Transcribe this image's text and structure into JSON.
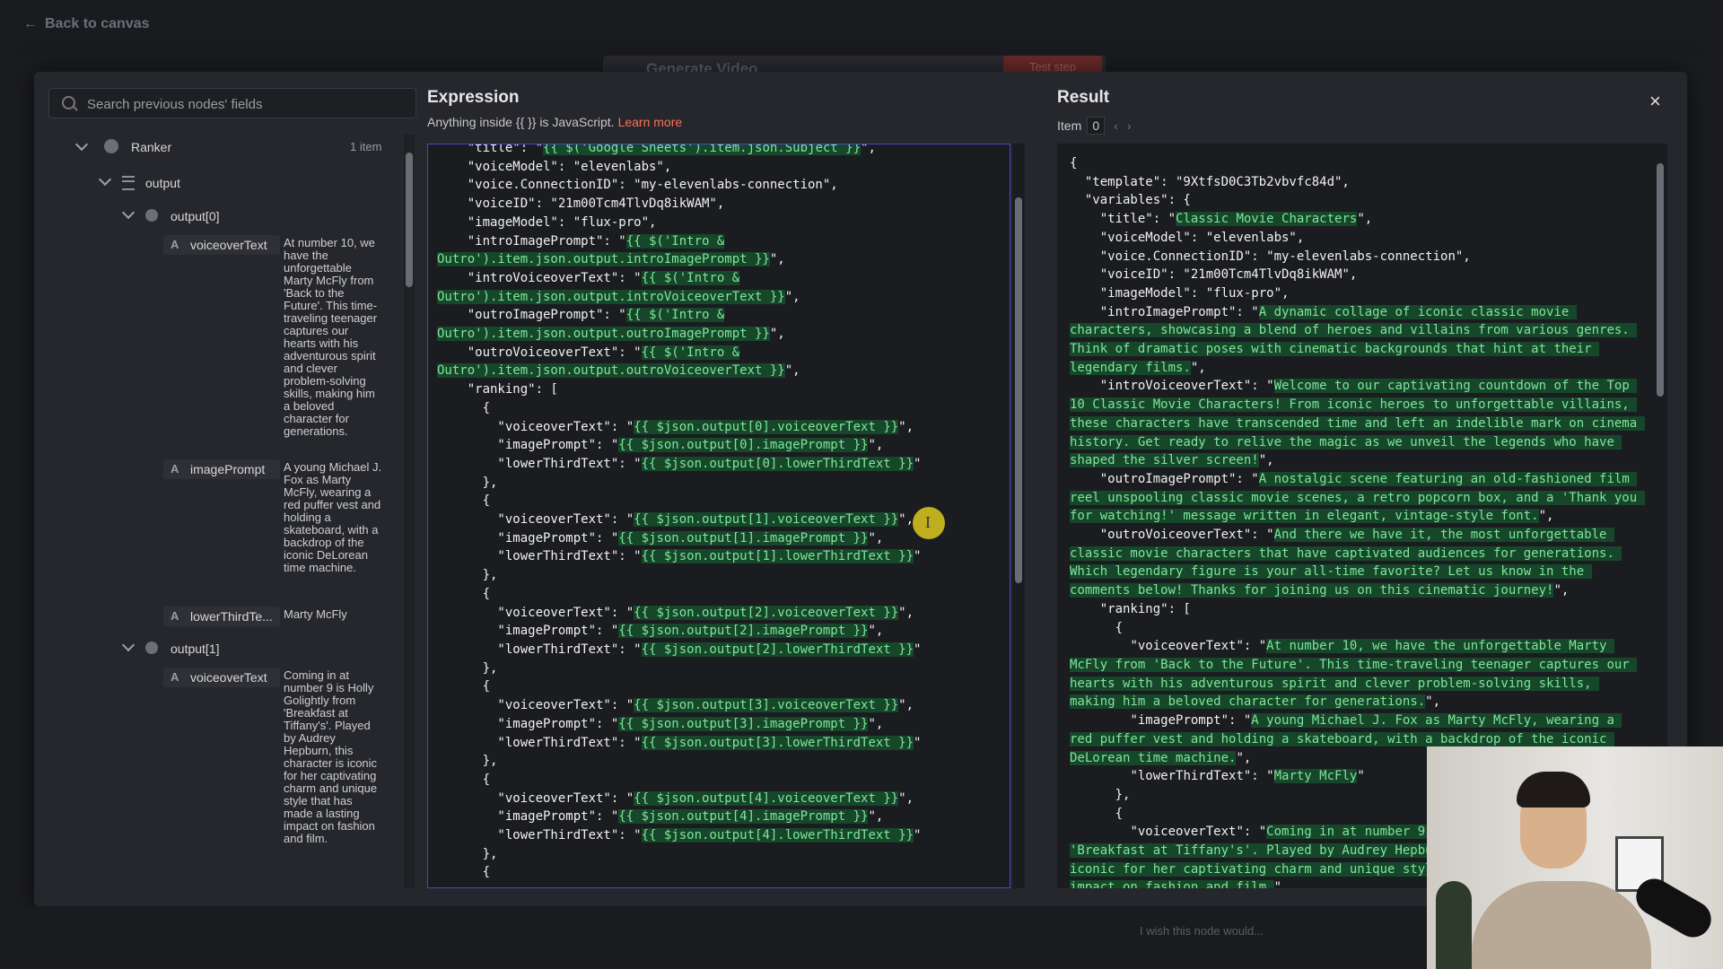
{
  "topbar": {
    "back_label": "Back to canvas",
    "node_title": "Generate Video",
    "test_step": "Test step"
  },
  "search": {
    "placeholder": "Search previous nodes' fields"
  },
  "tree": {
    "root_label": "Ranker",
    "root_count": "1 item",
    "output_label": "output",
    "items": [
      {
        "label": "output[0]",
        "fields": [
          {
            "type": "A",
            "name": "voiceoverText",
            "value": "At number 10, we have the unforgettable Marty McFly from 'Back to the Future'. This time-traveling teenager captures our hearts with his adventurous spirit and clever problem-solving skills, making him a beloved character for generations."
          },
          {
            "type": "A",
            "name": "imagePrompt",
            "value": "A young Michael J. Fox as Marty McFly, wearing a red puffer vest and holding a skateboard, with a backdrop of the iconic DeLorean time machine."
          },
          {
            "type": "A",
            "name": "lowerThirdTe...",
            "value": "Marty McFly"
          }
        ]
      },
      {
        "label": "output[1]",
        "fields": [
          {
            "type": "A",
            "name": "voiceoverText",
            "value": "Coming in at number 9 is Holly Golightly from 'Breakfast at Tiffany's'. Played by Audrey Hepburn, this character is iconic for her captivating charm and unique style that has made a lasting impact on fashion and film."
          }
        ]
      }
    ]
  },
  "expression": {
    "title": "Expression",
    "subtitle": "Anything inside {{ }} is JavaScript.",
    "learn_more": "Learn more"
  },
  "result": {
    "title": "Result",
    "item_label": "Item",
    "item_index": "0",
    "close": "×"
  },
  "bottom": {
    "wish": "I wish this node would..."
  }
}
